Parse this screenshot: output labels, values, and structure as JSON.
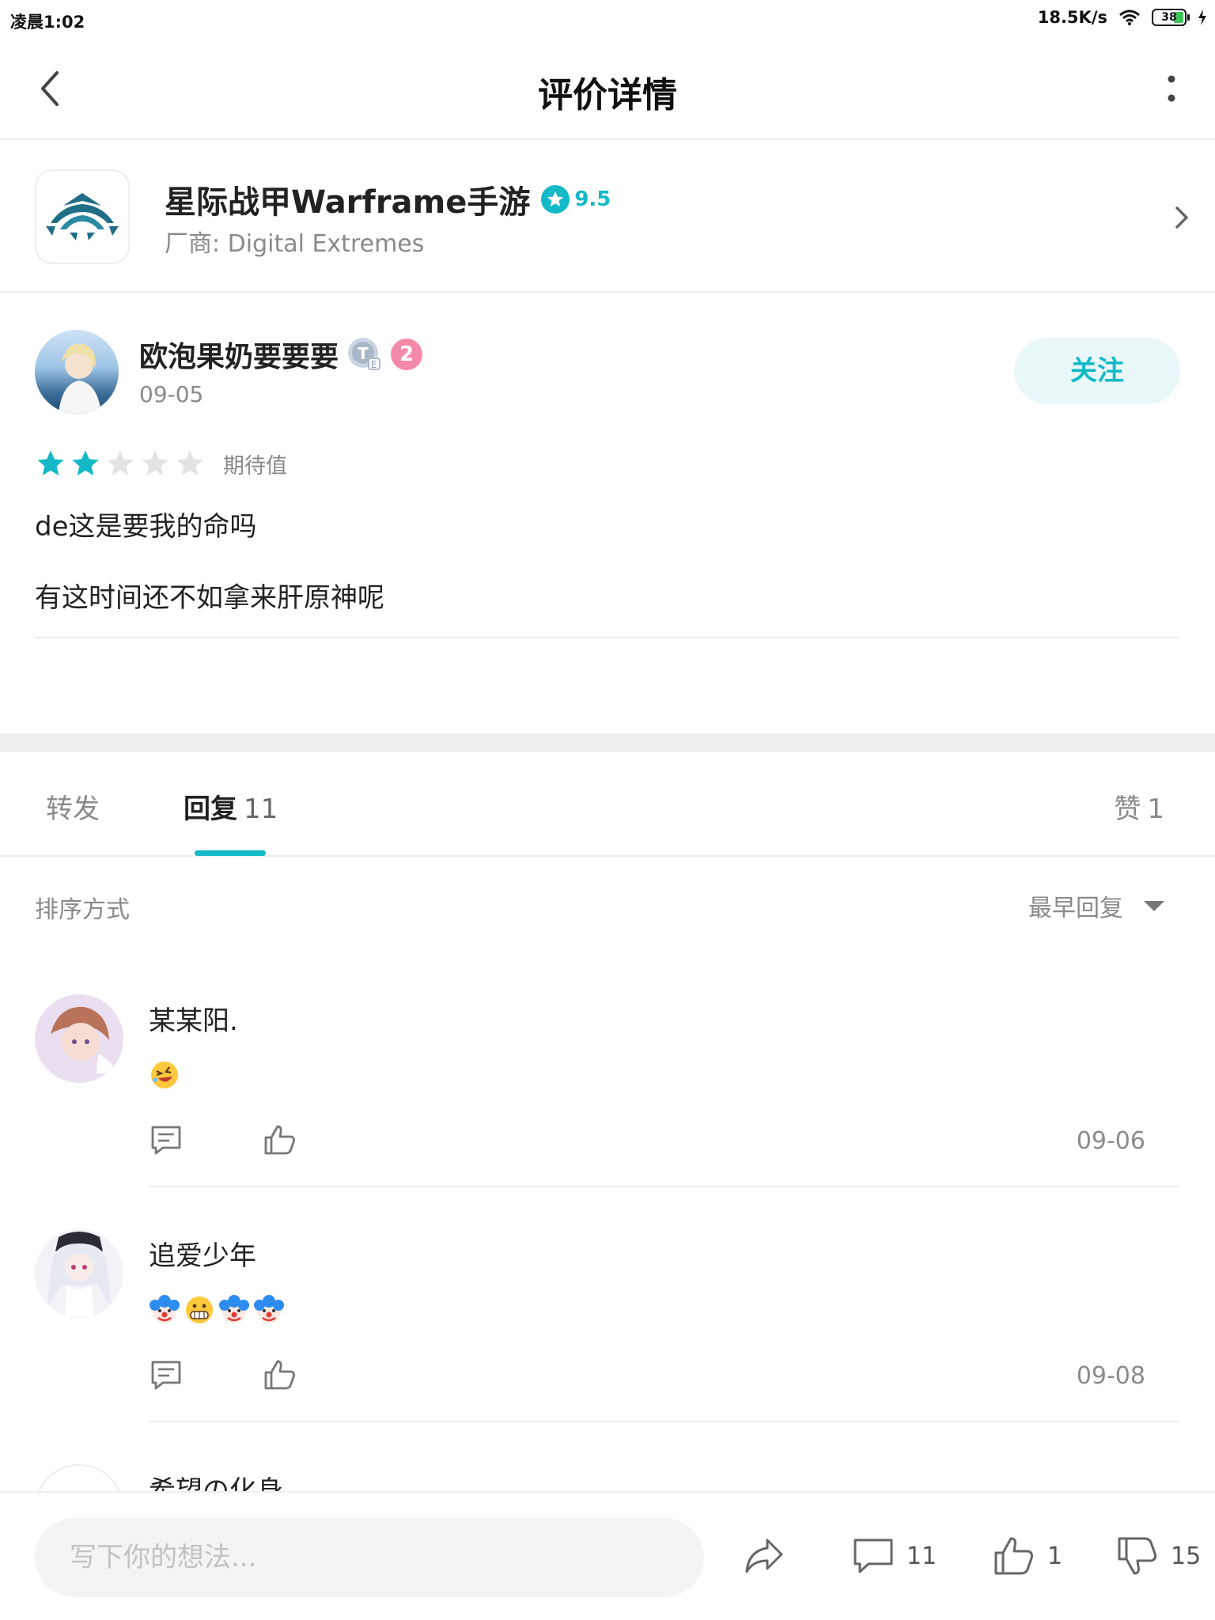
{
  "status_bar": {
    "time": "凌晨1:02",
    "network_speed": "18.5K/s",
    "battery": "38"
  },
  "nav": {
    "title": "评价详情"
  },
  "game": {
    "title": "星际战甲Warframe手游",
    "rating": "9.5",
    "vendor": "厂商: Digital Extremes"
  },
  "review": {
    "user_name": "欧泡果奶要要要",
    "badge_level": "2",
    "date": "09-05",
    "follow_label": "关注",
    "stars": 2,
    "stars_max": 5,
    "stars_label": "期待值",
    "lines": [
      "de这是要我的命吗",
      "有这时间还不如拿来肝原神呢"
    ]
  },
  "tabs": {
    "forward": {
      "label": "转发"
    },
    "reply": {
      "label": "回复",
      "count": "11"
    },
    "like": {
      "label": "赞",
      "count": "1"
    }
  },
  "sort": {
    "label": "排序方式",
    "selected": "最早回复"
  },
  "replies": [
    {
      "name": "某某阳.",
      "emojis": [
        "laughing-tears-emoji"
      ],
      "date": "09-06"
    },
    {
      "name": "追爱少年",
      "emojis": [
        "clown-emoji",
        "grin-emoji",
        "clown-emoji",
        "clown-emoji"
      ],
      "date": "09-08"
    },
    {
      "name": "希望の化身"
    }
  ],
  "bottom_bar": {
    "input_placeholder": "写下你的想法...",
    "comment_count": "11",
    "like_count": "1",
    "dislike_count": "15"
  },
  "colors": {
    "accent": "#14b9c8",
    "star_on": "#14b9c8",
    "star_off": "#e3e3e3"
  }
}
